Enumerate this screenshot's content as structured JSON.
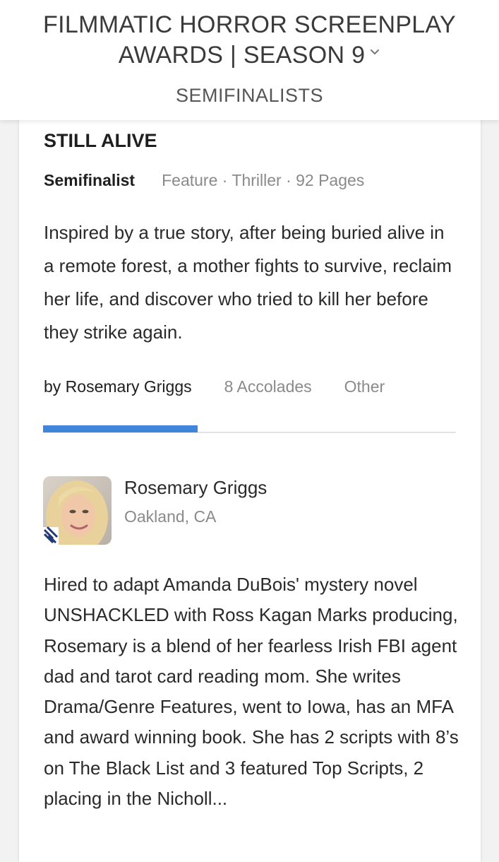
{
  "header": {
    "title": "FILMMATIC HORROR SCREENPLAY AWARDS | SEASON 9",
    "subtitle": "SEMIFINALISTS"
  },
  "project": {
    "title": "STILL ALIVE",
    "status": "Semifinalist",
    "details": "Feature · Thriller · 92 Pages",
    "logline": "Inspired by a true story, after being buried alive in a remote forest, a mother fights to survive, reclaim her life, and discover who tried to kill her before they strike again."
  },
  "tabs": [
    {
      "label": "by Rosemary Griggs",
      "active": true
    },
    {
      "label": "8 Accolades",
      "active": false
    },
    {
      "label": "Other",
      "active": false
    }
  ],
  "writer": {
    "name": "Rosemary Griggs",
    "location": "Oakland, CA",
    "bio": "Hired to adapt Amanda DuBois' mystery novel UNSHACKLED with Ross Kagan Marks producing, Rosemary is a blend of her fearless Irish FBI agent dad and tarot card reading mom. She writes Drama/Genre Features, went to Iowa, has an MFA and award winning book. She has 2 scripts with 8’s on The Black List and 3 featured Top Scripts, 2 placing in the Nicholl..."
  },
  "colors": {
    "accent": "#3f86db",
    "text": "#2a2a2a",
    "muted": "#8a8a8a",
    "background": "#f2f2f2"
  },
  "icons": [
    "chevron-down-icon",
    "avatar-photo"
  ]
}
